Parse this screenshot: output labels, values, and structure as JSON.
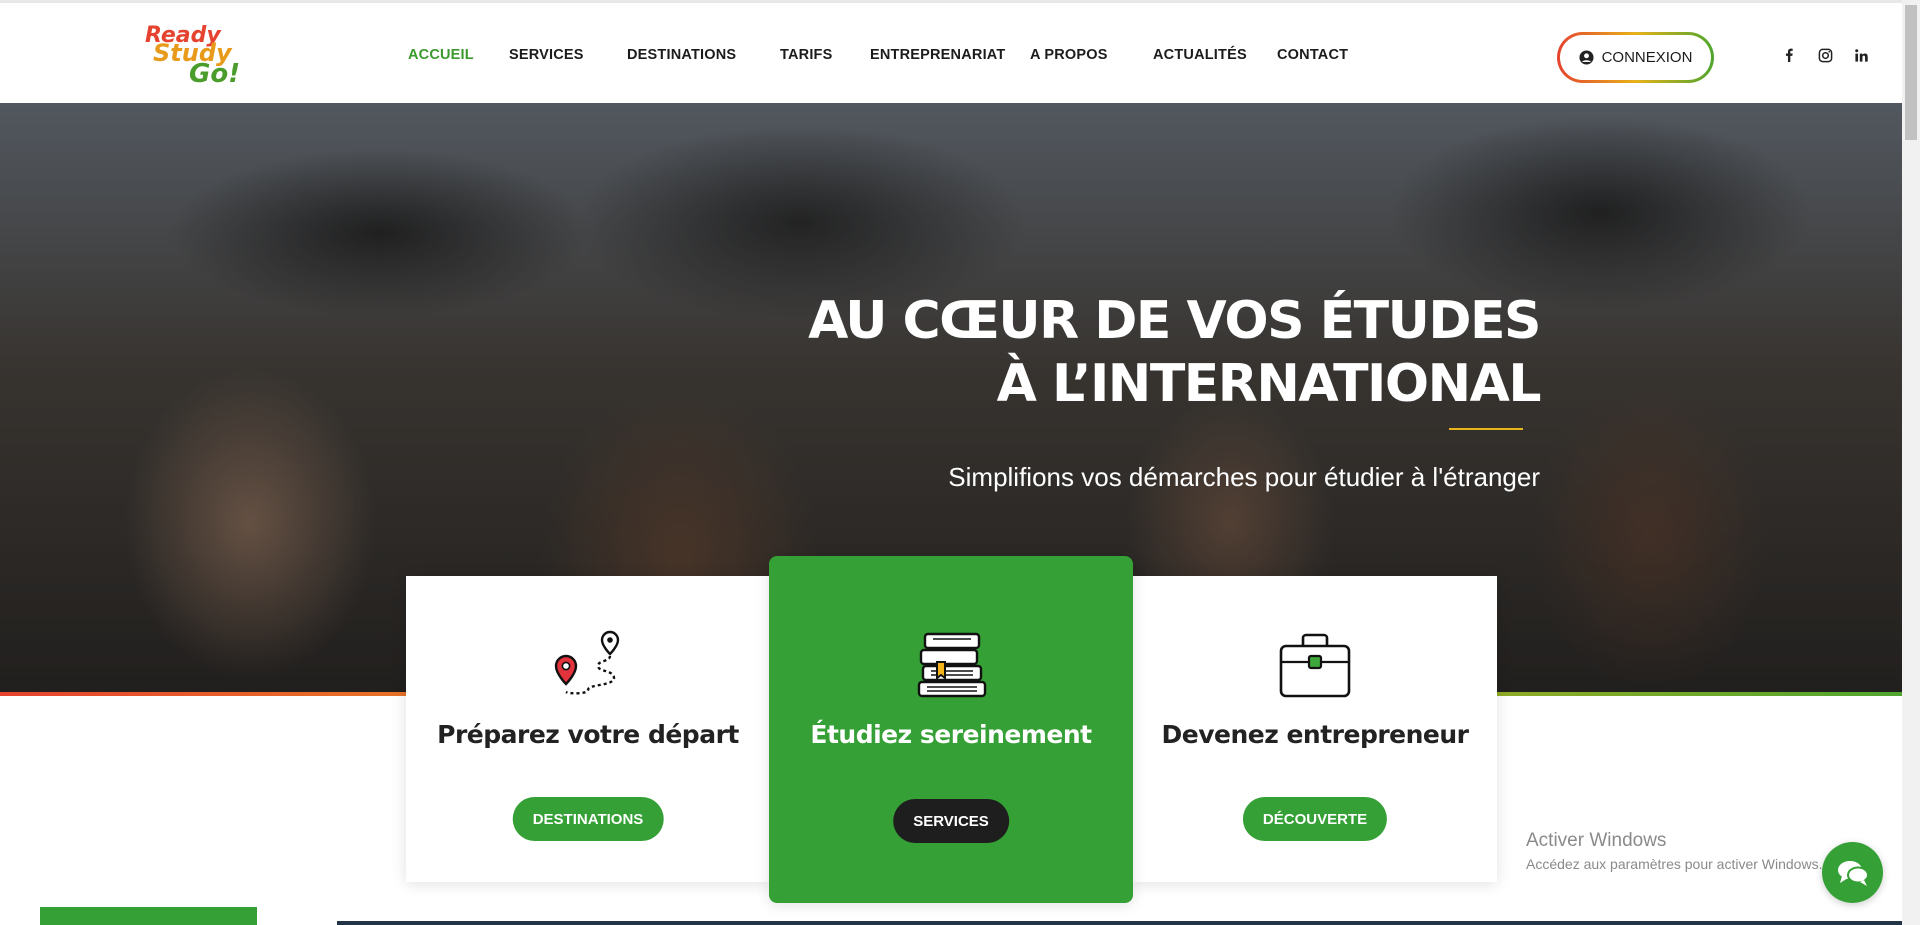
{
  "logo": {
    "line1": "Ready",
    "line2": "Study",
    "line3": "Go!"
  },
  "nav": {
    "items": [
      {
        "label": "ACCUEIL",
        "active": true
      },
      {
        "label": "SERVICES"
      },
      {
        "label": "DESTINATIONS"
      },
      {
        "label": "TARIFS"
      },
      {
        "label": "ENTREPRENARIAT"
      },
      {
        "label": "A PROPOS"
      },
      {
        "label": "ACTUALITÉS"
      },
      {
        "label": "CONTACT"
      }
    ]
  },
  "header": {
    "login_label": "CONNEXION"
  },
  "socials": [
    "facebook-icon",
    "instagram-icon",
    "linkedin-icon"
  ],
  "hero": {
    "title_line1": "AU CŒUR DE VOS ÉTUDES",
    "title_line2": "À L’INTERNATIONAL",
    "subtitle": "Simplifions vos démarches pour étudier à l'étranger"
  },
  "cards": [
    {
      "title": "Préparez votre départ",
      "button": "DESTINATIONS",
      "icon": "map-route-icon"
    },
    {
      "title": "Étudiez sereinement",
      "button": "SERVICES",
      "icon": "books-icon"
    },
    {
      "title": "Devenez entrepreneur",
      "button": "DÉCOUVERTE",
      "icon": "briefcase-icon"
    }
  ],
  "watermark": {
    "line1": "Activer Windows",
    "line2": "Accédez aux paramètres pour activer Windows."
  },
  "colors": {
    "brand_green": "#35a035",
    "brand_red": "#e5432f",
    "brand_yellow": "#e8b21b",
    "dark": "#1e1e1e"
  }
}
